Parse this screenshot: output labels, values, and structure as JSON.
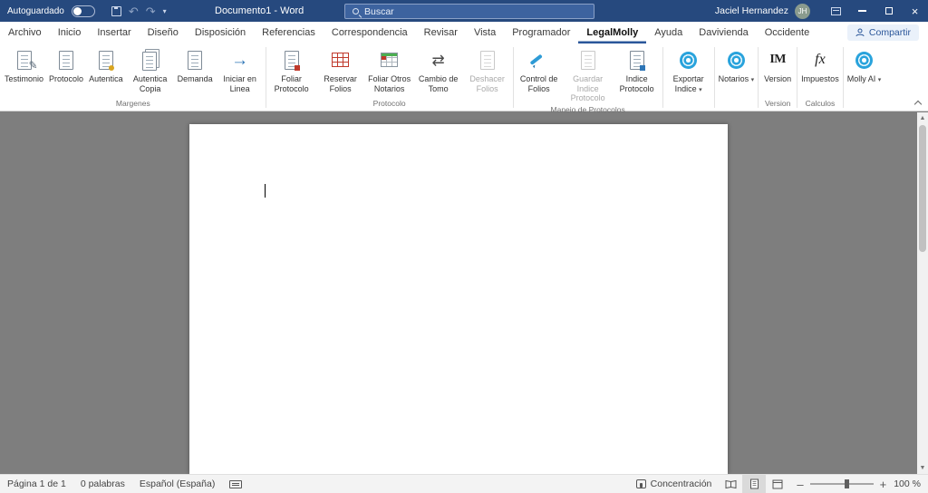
{
  "titlebar": {
    "autosave_label": "Autoguardado",
    "document_title": "Documento1  -  Word",
    "search_placeholder": "Buscar",
    "user_name": "Jaciel Hernandez",
    "user_initials": "JH"
  },
  "ribbon": {
    "share_label": "Compartir",
    "tabs": [
      {
        "label": "Archivo"
      },
      {
        "label": "Inicio"
      },
      {
        "label": "Insertar"
      },
      {
        "label": "Diseño"
      },
      {
        "label": "Disposición"
      },
      {
        "label": "Referencias"
      },
      {
        "label": "Correspondencia"
      },
      {
        "label": "Revisar"
      },
      {
        "label": "Vista"
      },
      {
        "label": "Programador"
      },
      {
        "label": "LegalMolly",
        "active": true
      },
      {
        "label": "Ayuda"
      },
      {
        "label": "Davivienda"
      },
      {
        "label": "Occidente"
      }
    ],
    "groups": [
      {
        "title": "Margenes",
        "buttons": [
          {
            "label": "Testimonio"
          },
          {
            "label": "Protocolo"
          },
          {
            "label": "Autentica"
          },
          {
            "label": "Autentica Copia"
          },
          {
            "label": "Demanda"
          },
          {
            "label": "Iniciar en Linea"
          }
        ]
      },
      {
        "title": "Protocolo",
        "buttons": [
          {
            "label": "Foliar Protocolo"
          },
          {
            "label": "Reservar Folios"
          },
          {
            "label": "Foliar Otros Notarios"
          },
          {
            "label": "Cambio de Tomo"
          },
          {
            "label": "Deshacer Folios",
            "disabled": true
          }
        ]
      },
      {
        "title": "Manejo de Protocolos",
        "buttons": [
          {
            "label": "Control de Folios"
          },
          {
            "label": "Guardar Indice Protocolo",
            "disabled": true
          },
          {
            "label": "Indice Protocolo"
          }
        ]
      },
      {
        "title": "",
        "buttons": [
          {
            "label": "Exportar Indice",
            "dropdown": true
          }
        ]
      },
      {
        "title": "",
        "buttons": [
          {
            "label": "Notarios",
            "dropdown": true
          }
        ]
      },
      {
        "title": "Version",
        "buttons": [
          {
            "label": "Version"
          }
        ]
      },
      {
        "title": "Calculos",
        "buttons": [
          {
            "label": "Impuestos"
          }
        ]
      },
      {
        "title": "",
        "buttons": [
          {
            "label": "Molly AI",
            "dropdown": true
          }
        ]
      }
    ],
    "icon_texts": {
      "version": "IM",
      "impuestos": "fx"
    }
  },
  "statusbar": {
    "page_indicator": "Página 1 de 1",
    "word_count": "0 palabras",
    "language": "Español (España)",
    "focus_label": "Concentración",
    "zoom_value": "100 %"
  }
}
